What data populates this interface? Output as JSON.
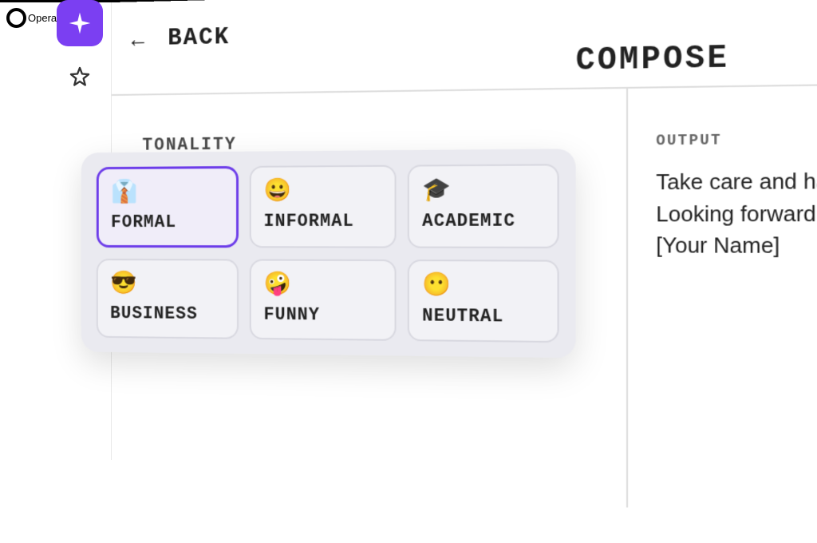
{
  "brand": {
    "name": "Opera"
  },
  "nav": {
    "back_label": "BACK"
  },
  "page_title": "COMPOSE",
  "tonality": {
    "label": "TONALITY",
    "options": [
      {
        "emoji": "👔",
        "label": "FORMAL",
        "selected": true
      },
      {
        "emoji": "😀",
        "label": "INFORMAL",
        "selected": false
      },
      {
        "emoji": "🎓",
        "label": "ACADEMIC",
        "selected": false
      },
      {
        "emoji": "😎",
        "label": "BUSINESS",
        "selected": false
      },
      {
        "emoji": "🤪",
        "label": "FUNNY",
        "selected": false
      },
      {
        "emoji": "😶",
        "label": "NEUTRAL",
        "selected": false
      }
    ]
  },
  "output": {
    "label": "OUTPUT",
    "text": "Take care and ha\nLooking forward\n[Your Name]"
  }
}
